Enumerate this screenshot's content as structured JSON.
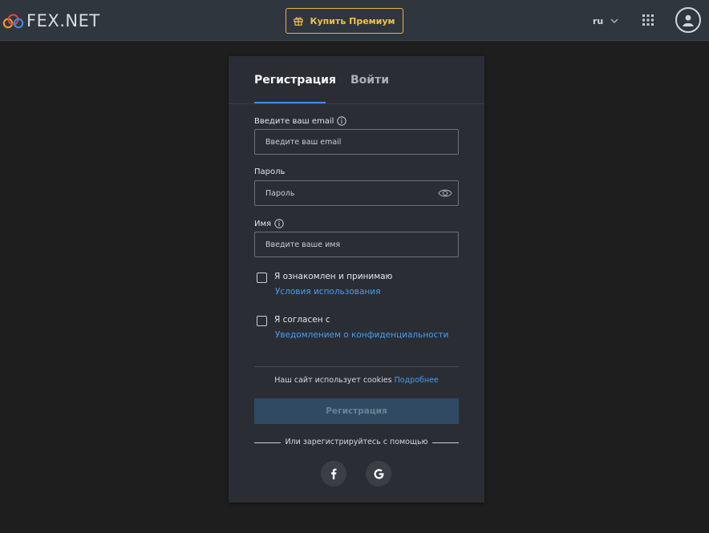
{
  "header": {
    "logo_text_main": "FEX",
    "logo_text_dot": ".",
    "logo_text_end": "NET",
    "premium_label": "Купить Премиум",
    "language": "ru"
  },
  "tabs": [
    {
      "label": "Регистрация",
      "active": true
    },
    {
      "label": "Войти",
      "active": false
    }
  ],
  "form": {
    "email": {
      "label": "Введите ваш email",
      "placeholder": "Введите ваш email"
    },
    "password": {
      "label": "Пароль",
      "placeholder": "Пароль"
    },
    "name": {
      "label": "Имя",
      "placeholder": "Введите ваше имя"
    },
    "terms": {
      "text": "Я ознакомлен и принимаю",
      "link": "Условия использования",
      "checked": false
    },
    "privacy": {
      "text": "Я согласен с",
      "link": "Уведомлением о конфиденциальности",
      "checked": false
    },
    "cookies_text": "Наш сайт использует cookies",
    "cookies_link": "Подробнее",
    "submit_label": "Регистрация",
    "or_text": "Или зарегистрируйтесь с помощью"
  },
  "social": [
    {
      "icon": "facebook-icon",
      "glyph": "f"
    },
    {
      "icon": "google-icon",
      "glyph": "G"
    }
  ],
  "colors": {
    "accent": "#3f8ce6",
    "link": "#4a9cf0",
    "premium": "#f0c04a",
    "topbar": "#30363e",
    "card": "#2a2e34",
    "background": "#1e1e1e"
  }
}
